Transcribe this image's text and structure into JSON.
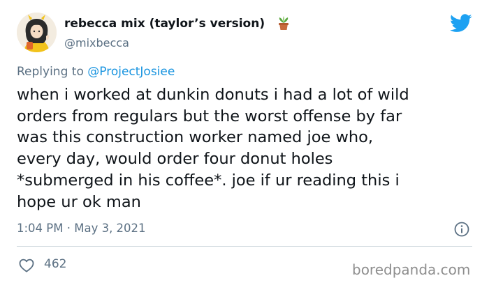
{
  "author": {
    "display_name": "rebecca mix (taylor’s version)",
    "handle": "@mixbecca",
    "name_emoji": "potted-plant-icon"
  },
  "reply": {
    "prefix": "Replying to ",
    "mention": "@ProjectJosiee"
  },
  "tweet": {
    "lines": [
      "when i worked at dunkin donuts i had a lot of wild",
      "orders from regulars but the worst offense by far",
      "was this construction worker named joe who,",
      "every day, would order four donut holes",
      "*submerged in his coffee*. joe if ur reading this i",
      "hope ur ok man"
    ],
    "timestamp": "1:04 PM · May 3, 2021"
  },
  "actions": {
    "like_count": "462"
  },
  "watermark": "boredpanda.com",
  "colors": {
    "twitter_blue": "#1da1f2",
    "mention_blue": "#1b95e0",
    "secondary_text": "#5b7083",
    "primary_text": "#0f1419"
  }
}
